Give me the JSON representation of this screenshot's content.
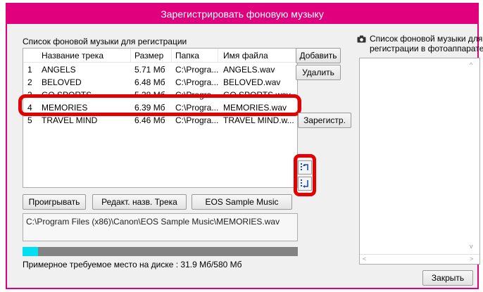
{
  "window": {
    "title": "Зарегистрировать фоновую музыку"
  },
  "left_panel": {
    "heading": "Список фоновой музыки для регистрации",
    "columns": [
      "Название трека",
      "Размер",
      "Папка",
      "Имя файла"
    ],
    "tracks": [
      {
        "num": "1",
        "name": "ANGELS",
        "size": "5.71 Мб",
        "folder": "C:\\Progra...",
        "file": "ANGELS.wav"
      },
      {
        "num": "2",
        "name": "BELOVED",
        "size": "6.48 Мб",
        "folder": "C:\\Progra...",
        "file": "BELOVED.wav"
      },
      {
        "num": "3",
        "name": "GO SPORTS",
        "size": "5.38 Мб",
        "folder": "C:\\Progra...",
        "file": "GO SPORTS.wav"
      },
      {
        "num": "4",
        "name": "MEMORIES",
        "size": "6.39 Мб",
        "folder": "C:\\Progra...",
        "file": "MEMORIES.wav"
      },
      {
        "num": "5",
        "name": "TRAVEL MIND",
        "size": "6.46 Мб",
        "folder": "C:\\Progra...",
        "file": "TRAVEL MIND.w..."
      }
    ],
    "selected_track": "MEMORIES"
  },
  "buttons": {
    "add": "Добавить",
    "delete": "Удалить",
    "register": "Зарегистр.",
    "play": "Проигрывать",
    "edit_name": "Редакт. назв. Трека",
    "eos_sample": "EOS Sample Music",
    "close": "Закрыть"
  },
  "path_display": "C:\\Program Files (x86)\\Canon\\EOS Sample Music\\MEMORIES.wav",
  "disk_usage": {
    "text": "Примерное требуемое место на диске : 31.9 Мб/580 Мб",
    "used_mb": 31.9,
    "total_mb": 580
  },
  "camera_panel": {
    "heading_line1": "Список фоновой музыки для",
    "heading_line2": "регистрации в фотоаппарате",
    "icon": "camera-icon"
  },
  "icons": {
    "move_up": "move-up-icon",
    "move_down": "move-down-icon"
  },
  "colors": {
    "titlebar": "#e0007e",
    "highlight": "#e30000",
    "progress_fill": "#00e0f2",
    "progress_track": "#838383"
  }
}
